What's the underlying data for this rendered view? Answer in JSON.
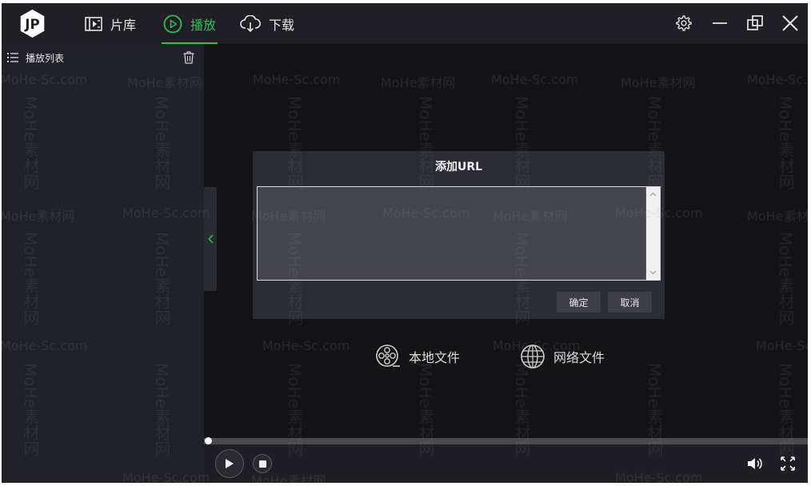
{
  "nav": {
    "library": "片库",
    "play": "播放",
    "download": "下载"
  },
  "sidebar": {
    "title": "播放列表"
  },
  "dialog": {
    "title": "添加URL",
    "url_value": "",
    "confirm": "确定",
    "cancel": "取消"
  },
  "player": {
    "local_file": "本地文件",
    "network_file": "网络文件",
    "progress": 0.0
  },
  "watermark": {
    "text_latin": "MoHe-Sc.com",
    "text_cn": "MoHe素材网"
  },
  "colors": {
    "accent": "#2fbf5a",
    "background": "#141417",
    "sidebar": "#212129",
    "dialog": "#2c2c34"
  },
  "icons": {
    "logo": "jp-logo",
    "library": "film-list-icon",
    "play": "play-circle-icon",
    "download": "cloud-download-icon",
    "settings": "gear-icon",
    "minimize": "minimize-icon",
    "maximize": "restore-icon",
    "close": "close-icon",
    "playlist": "list-icon",
    "trash": "trash-icon",
    "local": "film-reel-icon",
    "network": "globe-icon",
    "volume": "volume-icon",
    "fullscreen": "fullscreen-icon"
  }
}
